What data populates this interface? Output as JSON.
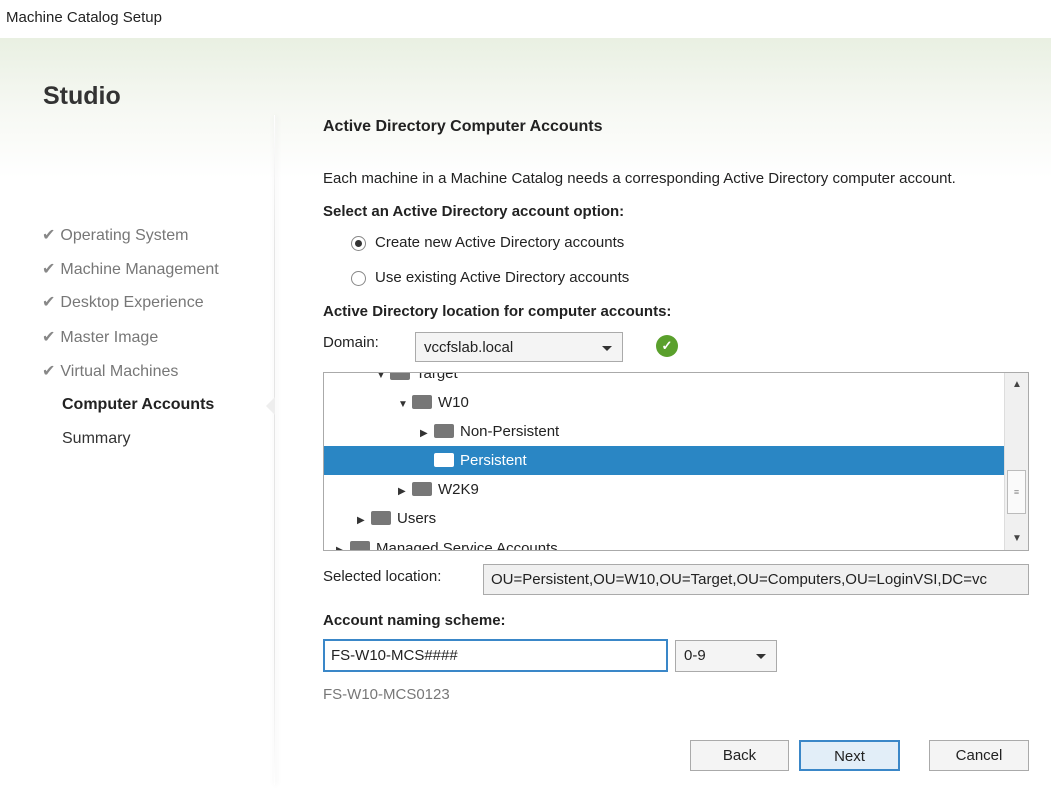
{
  "window": {
    "title": "Machine Catalog Setup"
  },
  "sidebar": {
    "brand": "Studio",
    "steps": [
      {
        "label": "Operating System",
        "state": "done"
      },
      {
        "label": "Machine Management",
        "state": "done"
      },
      {
        "label": "Desktop Experience",
        "state": "done"
      },
      {
        "label": "Master Image",
        "state": "done"
      },
      {
        "label": "Virtual Machines",
        "state": "done"
      },
      {
        "label": "Computer Accounts",
        "state": "current"
      },
      {
        "label": "Summary",
        "state": "pending"
      }
    ],
    "check_glyph": "✔"
  },
  "main": {
    "heading": "Active Directory Computer Accounts",
    "intro": "Each machine in a Machine Catalog needs a corresponding Active Directory computer account.",
    "option_label": "Select an Active Directory account option:",
    "options": [
      {
        "label": "Create new Active Directory accounts",
        "selected": true
      },
      {
        "label": "Use existing Active Directory accounts",
        "selected": false
      }
    ],
    "location_label": "Active Directory location for computer accounts:",
    "domain_label": "Domain:",
    "domain_value": "vccfslab.local",
    "domain_status_icon": "check-circle-icon",
    "tree": [
      {
        "label": "Target",
        "expanded": true
      },
      {
        "label": "W10",
        "expanded": true
      },
      {
        "label": "Non-Persistent",
        "expanded": false
      },
      {
        "label": "Persistent",
        "selected": true
      },
      {
        "label": "W2K9",
        "expanded": false
      },
      {
        "label": "Users",
        "expanded": false
      },
      {
        "label": "Managed Service Accounts",
        "expanded": false
      }
    ],
    "selected_location_label": "Selected location:",
    "selected_location": "OU=Persistent,OU=W10,OU=Target,OU=Computers,OU=LoginVSI,DC=vc",
    "naming_label": "Account naming scheme:",
    "naming_value": "FS-W10-MCS####",
    "naming_type": "0-9",
    "naming_preview": "FS-W10-MCS0123"
  },
  "buttons": {
    "back": "Back",
    "next": "Next",
    "cancel": "Cancel"
  },
  "colors": {
    "selection": "#2a86c4",
    "ok": "#5aa02c"
  }
}
